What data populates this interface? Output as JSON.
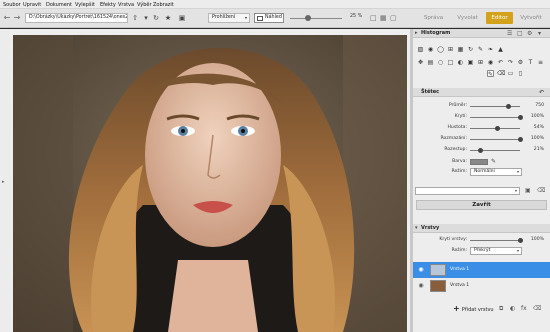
{
  "menu": [
    "Soubor",
    "Upravit",
    "Dokument",
    "Vylepšit",
    "Efekty",
    "Vrstva",
    "Výběr",
    "Zobrazit"
  ],
  "toolbar": {
    "path": "D:\\Obrázky\\Ukázky\\Portrét\\161524\\ones2",
    "browse_label": "Prohlížení",
    "preview_label": "Náhled",
    "zoom": "25 %",
    "zoom_level": 0.35
  },
  "modes": {
    "manage": "Správa",
    "develop": "Vyvolat",
    "editor": "Editor",
    "create": "Vytvořit"
  },
  "colors": {
    "accent": "#d4a21a",
    "selection": "#3a8ee6"
  },
  "histogram": {
    "title": "Histogram"
  },
  "brush": {
    "title": "Štětec",
    "params": [
      {
        "label": "Průměr:",
        "value": "750",
        "level": 0.77
      },
      {
        "label": "Krytí:",
        "value": "100%",
        "level": 1.0
      },
      {
        "label": "Hustota:",
        "value": "54%",
        "level": 0.54
      },
      {
        "label": "Rozmazání:",
        "value": "100%",
        "level": 1.0
      },
      {
        "label": "Rozestup:",
        "value": "21%",
        "level": 0.21
      }
    ],
    "color_label": "Barva:",
    "mode_label": "Režim:",
    "mode_value": "Normální",
    "close_label": "Zavřít"
  },
  "layers": {
    "title": "Vrstvy",
    "opacity_label": "Krytí vrstvy:",
    "opacity_value": "100%",
    "opacity_level": 1.0,
    "mode_label": "Režim:",
    "mode_value": "Překrýt",
    "items": [
      {
        "name": "Vrstva 1",
        "selected": true
      },
      {
        "name": "Vrstva 1",
        "selected": false
      }
    ],
    "add_label": "Přidat vrstvu"
  }
}
